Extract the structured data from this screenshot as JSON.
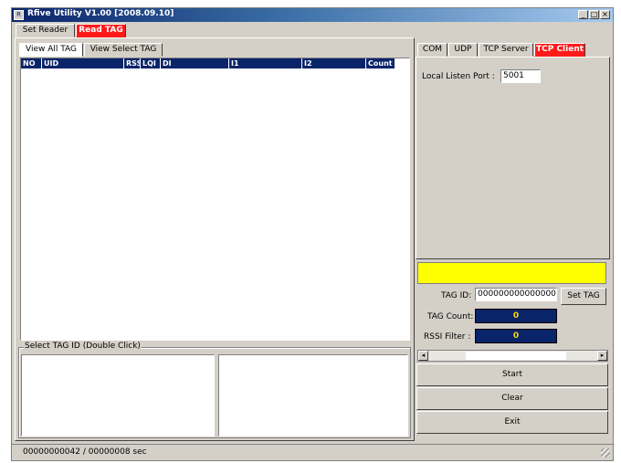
{
  "window": {
    "title": "Rfive Utility V1.00 [2008.09.10]",
    "min_glyph": "_",
    "max_glyph": "□",
    "close_glyph": "×"
  },
  "main_tabs": [
    {
      "label": "Set Reader"
    },
    {
      "label": "Read TAG"
    }
  ],
  "sub_tabs": [
    {
      "label": "View All TAG"
    },
    {
      "label": "View Select TAG"
    }
  ],
  "tag_table": {
    "columns": [
      "NO",
      "UID",
      "RSSI",
      "LQI",
      "DI",
      "I1",
      "I2",
      "Count"
    ],
    "rows": []
  },
  "select_group": {
    "title": "Select TAG ID (Double Click)"
  },
  "comm_tabs": [
    {
      "label": "COM"
    },
    {
      "label": "UDP"
    },
    {
      "label": "TCP Server"
    },
    {
      "label": "TCP Client"
    }
  ],
  "tcp_client": {
    "port_label": "Local Listen Port :",
    "port_value": "5001"
  },
  "tag_form": {
    "tag_id_label": "TAG ID:",
    "tag_id_value": "0000000000000000",
    "set_tag_label": "Set TAG",
    "tag_count_label": "TAG Count:",
    "tag_count_value": "0",
    "rssi_filter_label": "RSSI Filter :",
    "rssi_filter_value": "0"
  },
  "scroll_arrows": {
    "left": "◂",
    "right": "▸"
  },
  "buttons": {
    "start": "Start",
    "clear": "Clear",
    "exit": "Exit"
  },
  "status": {
    "text": "00000000042 / 00000008 sec"
  }
}
